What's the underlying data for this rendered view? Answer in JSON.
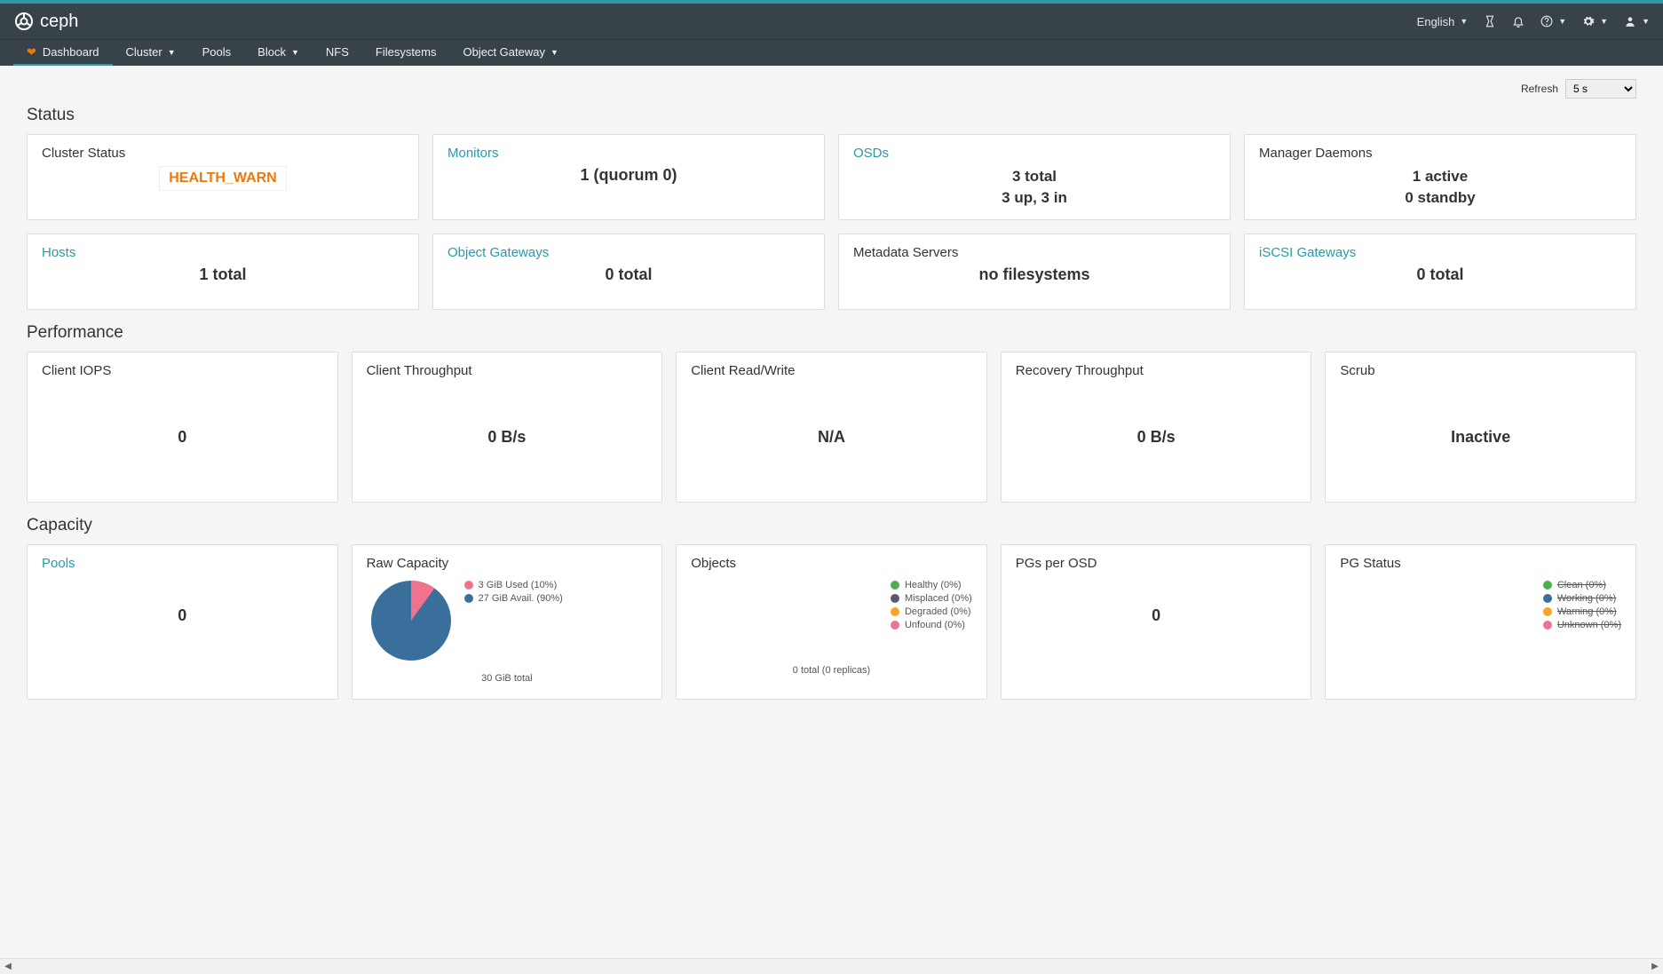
{
  "topbar": {
    "brand": "ceph",
    "language": "English",
    "right_icons": [
      "hourglass",
      "bell",
      "help",
      "gear",
      "user"
    ]
  },
  "nav": {
    "dashboard": "Dashboard",
    "cluster": "Cluster",
    "pools": "Pools",
    "block": "Block",
    "nfs": "NFS",
    "filesystems": "Filesystems",
    "object_gateway": "Object Gateway"
  },
  "refresh": {
    "label": "Refresh",
    "value": "5 s"
  },
  "status": {
    "heading": "Status",
    "cluster_status": {
      "title": "Cluster Status",
      "value": "HEALTH_WARN"
    },
    "monitors": {
      "title": "Monitors",
      "value": "1 (quorum 0)"
    },
    "osds": {
      "title": "OSDs",
      "line1": "3 total",
      "line2": "3 up, 3 in"
    },
    "mgr": {
      "title": "Manager Daemons",
      "line1": "1 active",
      "line2": "0 standby"
    },
    "hosts": {
      "title": "Hosts",
      "value": "1 total"
    },
    "obj_gw": {
      "title": "Object Gateways",
      "value": "0 total"
    },
    "mds": {
      "title": "Metadata Servers",
      "value": "no filesystems"
    },
    "iscsi": {
      "title": "iSCSI Gateways",
      "value": "0 total"
    }
  },
  "performance": {
    "heading": "Performance",
    "iops": {
      "title": "Client IOPS",
      "value": "0"
    },
    "throughput": {
      "title": "Client Throughput",
      "value": "0 B/s"
    },
    "rw": {
      "title": "Client Read/Write",
      "value": "N/A"
    },
    "recovery": {
      "title": "Recovery Throughput",
      "value": "0 B/s"
    },
    "scrub": {
      "title": "Scrub",
      "value": "Inactive"
    }
  },
  "capacity": {
    "heading": "Capacity",
    "pools": {
      "title": "Pools",
      "value": "0"
    },
    "raw": {
      "title": "Raw Capacity",
      "total_label": "30 GiB total",
      "legend": [
        {
          "label": "3 GiB Used (10%)",
          "color": "#f0728c"
        },
        {
          "label": "27 GiB Avail. (90%)",
          "color": "#3a6f9c"
        }
      ]
    },
    "objects": {
      "title": "Objects",
      "total_label": "0 total (0 replicas)",
      "legend": [
        {
          "label": "Healthy (0%)",
          "color": "#4caf50"
        },
        {
          "label": "Misplaced (0%)",
          "color": "#5d5a6f"
        },
        {
          "label": "Degraded (0%)",
          "color": "#f5a623"
        },
        {
          "label": "Unfound (0%)",
          "color": "#f0728c"
        }
      ]
    },
    "pgs_per_osd": {
      "title": "PGs per OSD",
      "value": "0"
    },
    "pg_status": {
      "title": "PG Status",
      "legend": [
        {
          "label": "Clean (0%)",
          "color": "#4caf50",
          "strike": true
        },
        {
          "label": "Working (0%)",
          "color": "#3a6f9c",
          "strike": true
        },
        {
          "label": "Warning (0%)",
          "color": "#f5a623",
          "strike": true
        },
        {
          "label": "Unknown (0%)",
          "color": "#f0728c",
          "strike": true
        }
      ]
    }
  },
  "chart_data": {
    "type": "pie",
    "title": "Raw Capacity",
    "series": [
      {
        "name": "Used",
        "value": 3,
        "unit": "GiB",
        "percent": 10,
        "color": "#f0728c"
      },
      {
        "name": "Avail.",
        "value": 27,
        "unit": "GiB",
        "percent": 90,
        "color": "#3a6f9c"
      }
    ],
    "total": {
      "value": 30,
      "unit": "GiB"
    }
  }
}
